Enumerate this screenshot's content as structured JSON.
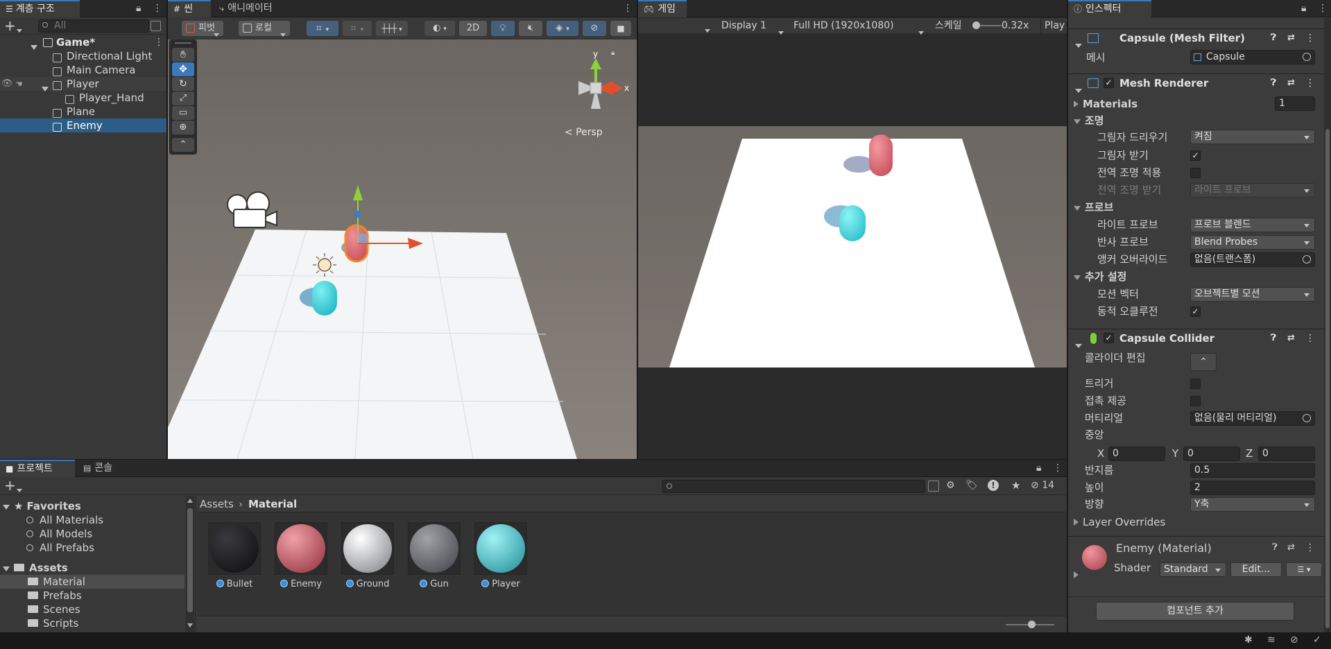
{
  "hierarchy": {
    "tab_label": "계층 구조",
    "search_placeholder": "All",
    "scene_name": "Game*",
    "items": [
      {
        "label": "Directional Light"
      },
      {
        "label": "Main Camera"
      },
      {
        "label": "Player"
      },
      {
        "label": "Player_Hand"
      },
      {
        "label": "Plane"
      },
      {
        "label": "Enemy"
      }
    ]
  },
  "scene_view": {
    "tab_scene": "씬",
    "tab_animator": "애니메이터",
    "pivot_label": "피벗",
    "local_label": "로컬",
    "btn_2d": "2D",
    "persp_label": "Persp",
    "gizmo_y": "y",
    "gizmo_x": "x"
  },
  "game_view": {
    "tab_label": "게임",
    "display": "Display 1",
    "resolution": "Full HD (1920x1080)",
    "scale_label": "스케일",
    "scale_value": "0.32x",
    "play_label": "Play"
  },
  "inspector": {
    "tab_label": "인스펙터",
    "mesh_filter": {
      "title": "Capsule (Mesh Filter)",
      "mesh_label": "메시",
      "mesh_value": "Capsule"
    },
    "mesh_renderer": {
      "title": "Mesh Renderer",
      "materials_label": "Materials",
      "materials_count": "1",
      "lighting_title": "조명",
      "cast_shadows_label": "그림자 드리우기",
      "cast_shadows_value": "켜짐",
      "receive_shadows_label": "그림자 받기",
      "contribute_gi_label": "전역 조명 적용",
      "receive_gi_label": "전역 조명 받기",
      "receive_gi_value": "라이트 프로브",
      "probes_title": "프로브",
      "light_probes_label": "라이트 프로브",
      "light_probes_value": "프로브 블렌드",
      "reflection_probes_label": "반사 프로브",
      "reflection_probes_value": "Blend Probes",
      "anchor_override_label": "앵커 오버라이드",
      "anchor_override_value": "없음(트랜스폼)",
      "additional_title": "추가 설정",
      "motion_vectors_label": "모션 벡터",
      "motion_vectors_value": "오브젝트별 모션",
      "dynamic_occlusion_label": "동적 오클루전"
    },
    "capsule_collider": {
      "title": "Capsule Collider",
      "edit_collider_label": "콜라이더 편집",
      "trigger_label": "트리거",
      "provides_contacts_label": "접촉 제공",
      "material_label": "머티리얼",
      "material_value": "없음(물리 머티리얼)",
      "center_label": "중앙",
      "center_x": "0",
      "center_y": "0",
      "center_z": "0",
      "axis_x": "X",
      "axis_y": "Y",
      "axis_z": "Z",
      "radius_label": "반지름",
      "radius_value": "0.5",
      "height_label": "높이",
      "height_value": "2",
      "direction_label": "방향",
      "direction_value": "Y축",
      "layer_overrides_label": "Layer Overrides"
    },
    "material": {
      "name": "Enemy (Material)",
      "shader_label": "Shader",
      "shader_value": "Standard",
      "edit_label": "Edit..."
    },
    "add_component_label": "컴포넌트 추가"
  },
  "project": {
    "tab_project": "프로젝트",
    "tab_console": "콘솔",
    "hidden_count": "14",
    "favorites_label": "Favorites",
    "favorites": [
      {
        "label": "All Materials"
      },
      {
        "label": "All Models"
      },
      {
        "label": "All Prefabs"
      }
    ],
    "assets_label": "Assets",
    "folders": [
      {
        "label": "Material"
      },
      {
        "label": "Prefabs"
      },
      {
        "label": "Scenes"
      },
      {
        "label": "Scripts"
      }
    ],
    "breadcrumb_root": "Assets",
    "breadcrumb_current": "Material",
    "assets": [
      {
        "name": "Bullet",
        "color": "#1c1c1e"
      },
      {
        "name": "Enemy",
        "color": "#c0505c"
      },
      {
        "name": "Ground",
        "color": "#e8e8ea"
      },
      {
        "name": "Gun",
        "color": "#6a6c70"
      },
      {
        "name": "Player",
        "color": "#3bc4cc"
      }
    ]
  },
  "colors": {
    "accent": "#3a79bb",
    "selection": "#2c5d87",
    "enemy": "#c0505c",
    "player": "#3bc4cc"
  }
}
